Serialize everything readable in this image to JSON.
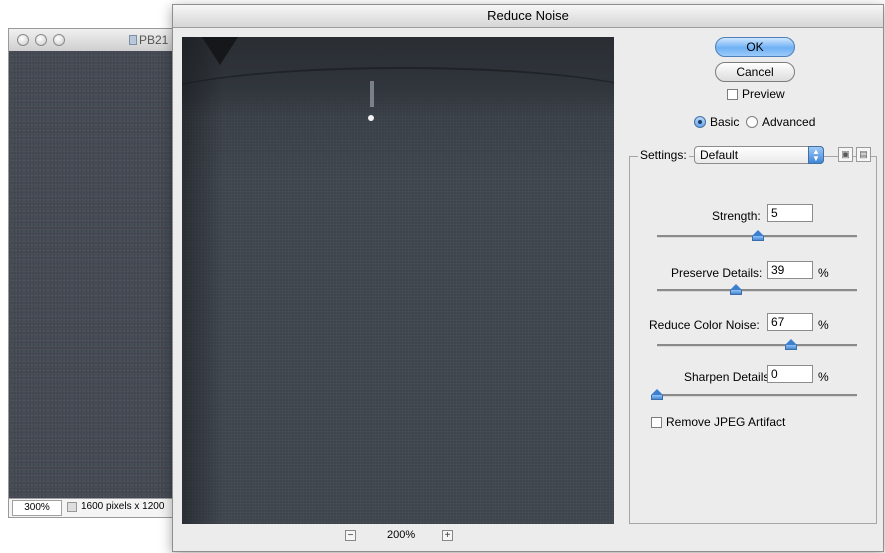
{
  "background_window": {
    "title": "PB21",
    "zoom": "300%",
    "size_info": "1600 pixels x 1200"
  },
  "dialog": {
    "title": "Reduce Noise",
    "zoom_level": "200%",
    "buttons": {
      "ok": "OK",
      "cancel": "Cancel"
    },
    "preview_label": "Preview",
    "mode": {
      "basic": "Basic",
      "advanced": "Advanced",
      "selected": "Basic"
    },
    "settings": {
      "label": "Settings:",
      "value": "Default"
    },
    "controls": [
      {
        "label": "Strength:",
        "value": "5",
        "unit": "",
        "level": 0.5
      },
      {
        "label": "Preserve Details:",
        "value": "39",
        "unit": "%",
        "level": 0.39
      },
      {
        "label": "Reduce Color Noise:",
        "value": "67",
        "unit": "%",
        "level": 0.67
      },
      {
        "label": "Sharpen Details:",
        "value": "0",
        "unit": "%",
        "level": 0.0
      }
    ],
    "remove_jpeg_label": "Remove JPEG Artifact"
  },
  "colors": {
    "accent": "#6fb1f4",
    "preview_bg": "#3d434b"
  }
}
